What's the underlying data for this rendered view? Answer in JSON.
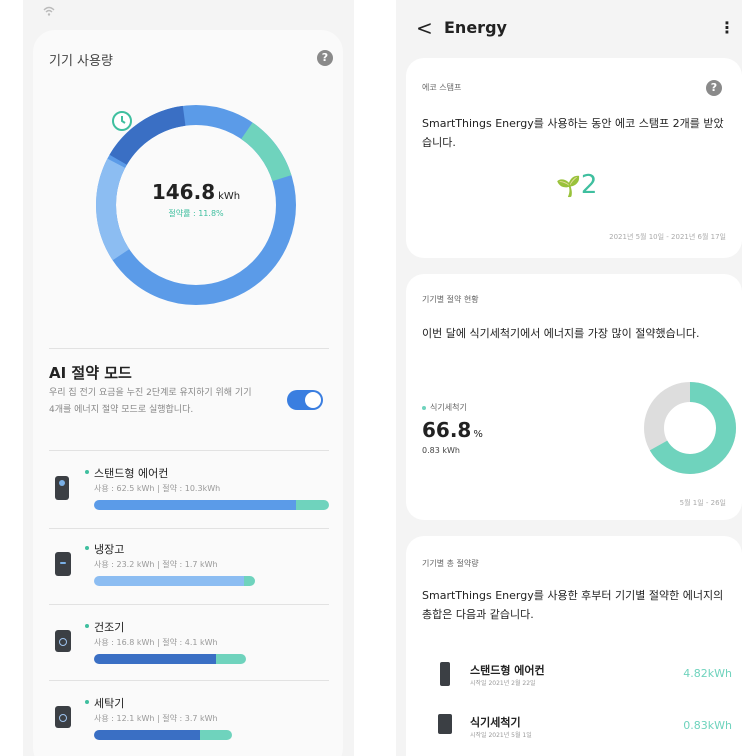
{
  "left": {
    "card_title": "기기 사용량",
    "help_glyph": "?",
    "usage_kwh": "146.8",
    "usage_unit": "kWh",
    "save_rate": "절약률 : 11.8%",
    "ai_mode": {
      "title": "AI 절약 모드",
      "desc": "우리 집 전기 요금을 누진 2단계로 유지하기 위해 기기 4개를 에너지 절약 모드로 실행합니다.",
      "enabled": true
    },
    "devices": [
      {
        "name": "스탠드형 에어컨",
        "stats": "사용 : 62.5 kWh  |  절약 : 10.3kWh",
        "use": 62.5,
        "save": 10.3,
        "icon": "air-conditioner-icon"
      },
      {
        "name": "냉장고",
        "stats": "사용 : 23.2 kWh  |  절약 : 1.7 kWh",
        "use": 23.2,
        "save": 1.7,
        "icon": "refrigerator-icon"
      },
      {
        "name": "건조기",
        "stats": "사용 : 16.8 kWh  |  절약 : 4.1 kWh",
        "use": 16.8,
        "save": 4.1,
        "icon": "dryer-icon"
      },
      {
        "name": "세탁기",
        "stats": "사용 : 12.1 kWh  |  절약 : 3.7 kWh",
        "use": 12.1,
        "save": 3.7,
        "icon": "washer-icon"
      }
    ],
    "colors": {
      "blue": "#5b9be8",
      "dark_blue": "#3a6fc4",
      "teal": "#6fd3bd"
    }
  },
  "right": {
    "header": {
      "back_glyph": "<",
      "title": "Energy",
      "more_glyph": "⋮"
    },
    "eco_stamp": {
      "label": "에코 스탬프",
      "body": "SmartThings Energy를 사용하는 동안 에코 스탬프 2개를 받았습니다.",
      "count": "2",
      "date": "2021년 5월 10일 - 2021년 6월 17일"
    },
    "top_saver": {
      "label": "기기별 절약 현황",
      "body": "이번 달에 식기세척기에서 에너지를 가장 많이 절약했습니다.",
      "device": "식기세척기",
      "percent": "66.8",
      "percent_sign": "%",
      "kwh": "0.83 kWh",
      "percent_value": 66.8,
      "date": "5월 1일 - 26일"
    },
    "total_saved": {
      "label": "기기별 총 절약량",
      "body": "SmartThings Energy를 사용한 후부터 기기별 절약한 에너지의 총합은 다음과 같습니다.",
      "items": [
        {
          "name": "스탠드형 에어컨",
          "sub": "시작일 2021년 2월 22일",
          "value": "4.82kWh",
          "icon": "air-conditioner-icon"
        },
        {
          "name": "식기세척기",
          "sub": "시작일 2021년 5월 1일",
          "value": "0.83kWh",
          "icon": "dishwasher-icon"
        }
      ]
    }
  }
}
